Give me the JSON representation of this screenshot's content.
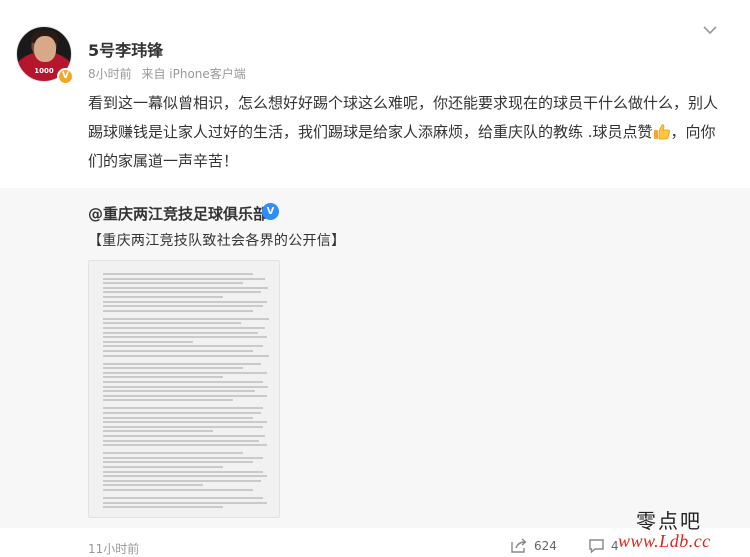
{
  "post": {
    "author": "5号李玮锋",
    "time": "8小时前",
    "source": "来自 iPhone客户端",
    "text_before_emoji": "看到这一幕似曾相识，怎么想好好踢个球这么难呢，你还能要求现在的球员干什么做什么，别人踢球赚钱是让家人过好的生活，我们踢球是给家人添麻烦，给重庆队的教练 .球员点赞",
    "text_after_emoji": "，向你们的家属道一声辛苦！",
    "emoji": "thumbs-up-icon",
    "avatar_jersey_text": "1000"
  },
  "repost": {
    "author": "@重庆两江竞技足球俱乐部",
    "title": "【重庆两江竞技队致社会各界的公开信】",
    "image": "open-letter-scan"
  },
  "footer": {
    "time": "11小时前",
    "share_count": "624",
    "comment_count": "4"
  },
  "watermark": {
    "cn": "零点吧",
    "url": "www.Ldb.cc"
  },
  "colors": {
    "accent_blue": "#2f8dff",
    "verified_gold": "#f5a623",
    "watermark_red": "#e2231a",
    "repost_bg": "#f7f7f7"
  }
}
